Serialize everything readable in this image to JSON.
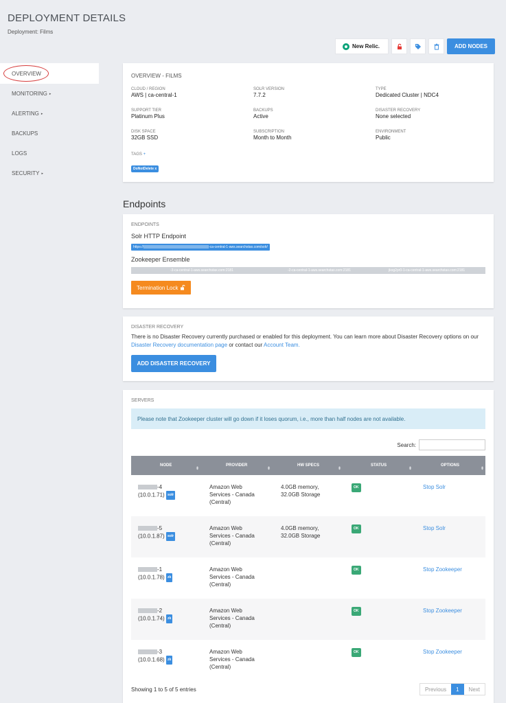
{
  "header": {
    "title": "DEPLOYMENT DETAILS",
    "subtitle": "Deployment: Films"
  },
  "toolbar": {
    "new_relic_label": "New Relic.",
    "add_nodes_label": "ADD NODES"
  },
  "sidebar": {
    "items": [
      {
        "label": "OVERVIEW",
        "active": true
      },
      {
        "label": "MONITORING",
        "caret": "▸"
      },
      {
        "label": "ALERTING",
        "caret": "▸"
      },
      {
        "label": "BACKUPS"
      },
      {
        "label": "LOGS"
      },
      {
        "label": "SECURITY",
        "caret": "▸"
      }
    ]
  },
  "overview": {
    "title": "OVERVIEW - FILMS",
    "fields": [
      {
        "label": "CLOUD / REGION",
        "value": "AWS | ca-central-1"
      },
      {
        "label": "SOLR VERSION",
        "value": "7.7.2"
      },
      {
        "label": "TYPE",
        "value": "Dedicated Cluster | NDC4"
      },
      {
        "label": "SUPPORT TIER",
        "value": "Platinum Plus"
      },
      {
        "label": "BACKUPS",
        "value": "Active"
      },
      {
        "label": "DISASTER RECOVERY",
        "value": "None selected"
      },
      {
        "label": "DISK SPACE",
        "value": "32GB SSD"
      },
      {
        "label": "SUBSCRIPTION",
        "value": "Month to Month"
      },
      {
        "label": "ENVIRONMENT",
        "value": "Public"
      }
    ],
    "tags_label": "TAGS",
    "tags_plus": "+",
    "tag": "DoNotDelete x"
  },
  "endpoints": {
    "heading": "Endpoints",
    "card_title": "ENDPOINTS",
    "solr_label": "Solr HTTP Endpoint",
    "solr_url_prefix": "https://",
    "solr_url_suffix": "-ca-central-1-aws.searchstax.com/solr/",
    "zk_label": "Zookeeper Ensemble",
    "zk_parts": [
      "-3-ca-central-1-aws.searchstax.com:2181",
      "-2-ca-central-1-aws.searchstax.com:2181",
      "jkog2pr0-1-ca-central-1-aws.searchstax.com:2181"
    ],
    "lock_label": "Termination Lock"
  },
  "disaster_recovery": {
    "title": "DISASTER RECOVERY",
    "text_1": "There is no Disaster Recovery currently purchased or enabled for this deployment. You can learn more about Disaster Recovery options on our",
    "link_1": "Disaster Recovery documentation page",
    "text_2": "or contact our",
    "link_2": "Account Team.",
    "button_label": "ADD DISASTER RECOVERY"
  },
  "servers": {
    "title": "SERVERS",
    "alert": "Please note that Zookeeper cluster will go down if it loses quorum, i.e., more than half nodes are not available.",
    "search_label": "Search:",
    "columns": [
      "NODE",
      "PROVIDER",
      "HW SPECS",
      "STATUS",
      "OPTIONS"
    ],
    "rows": [
      {
        "node_suffix": "-4",
        "ip": "(10.0.1.71)",
        "role": "solr",
        "provider": [
          "Amazon Web",
          "Services - Canada",
          "(Central)"
        ],
        "specs": [
          "4.0GB memory,",
          "32.0GB Storage"
        ],
        "status": "OK",
        "option": "Stop Solr"
      },
      {
        "node_suffix": "-5",
        "ip": "(10.0.1.87)",
        "role": "solr",
        "provider": [
          "Amazon Web",
          "Services - Canada",
          "(Central)"
        ],
        "specs": [
          "4.0GB memory,",
          "32.0GB Storage"
        ],
        "status": "OK",
        "option": "Stop Solr"
      },
      {
        "node_suffix": "-1",
        "ip": "(10.0.1.78)",
        "role": "zk",
        "provider": [
          "Amazon Web",
          "Services - Canada",
          "(Central)"
        ],
        "specs": [
          "",
          ""
        ],
        "status": "OK",
        "option": "Stop Zookeeper"
      },
      {
        "node_suffix": "-2",
        "ip": "(10.0.1.74)",
        "role": "zk",
        "provider": [
          "Amazon Web",
          "Services - Canada",
          "(Central)"
        ],
        "specs": [
          "",
          ""
        ],
        "status": "OK",
        "option": "Stop Zookeeper"
      },
      {
        "node_suffix": "-3",
        "ip": "(10.0.1.68)",
        "role": "zk",
        "provider": [
          "Amazon Web",
          "Services - Canada",
          "(Central)"
        ],
        "specs": [
          "",
          ""
        ],
        "status": "OK",
        "option": "Stop Zookeeper"
      }
    ],
    "footer": "Showing 1 to 5 of 5 entries",
    "pager": {
      "previous": "Previous",
      "current": "1",
      "next": "Next"
    }
  }
}
